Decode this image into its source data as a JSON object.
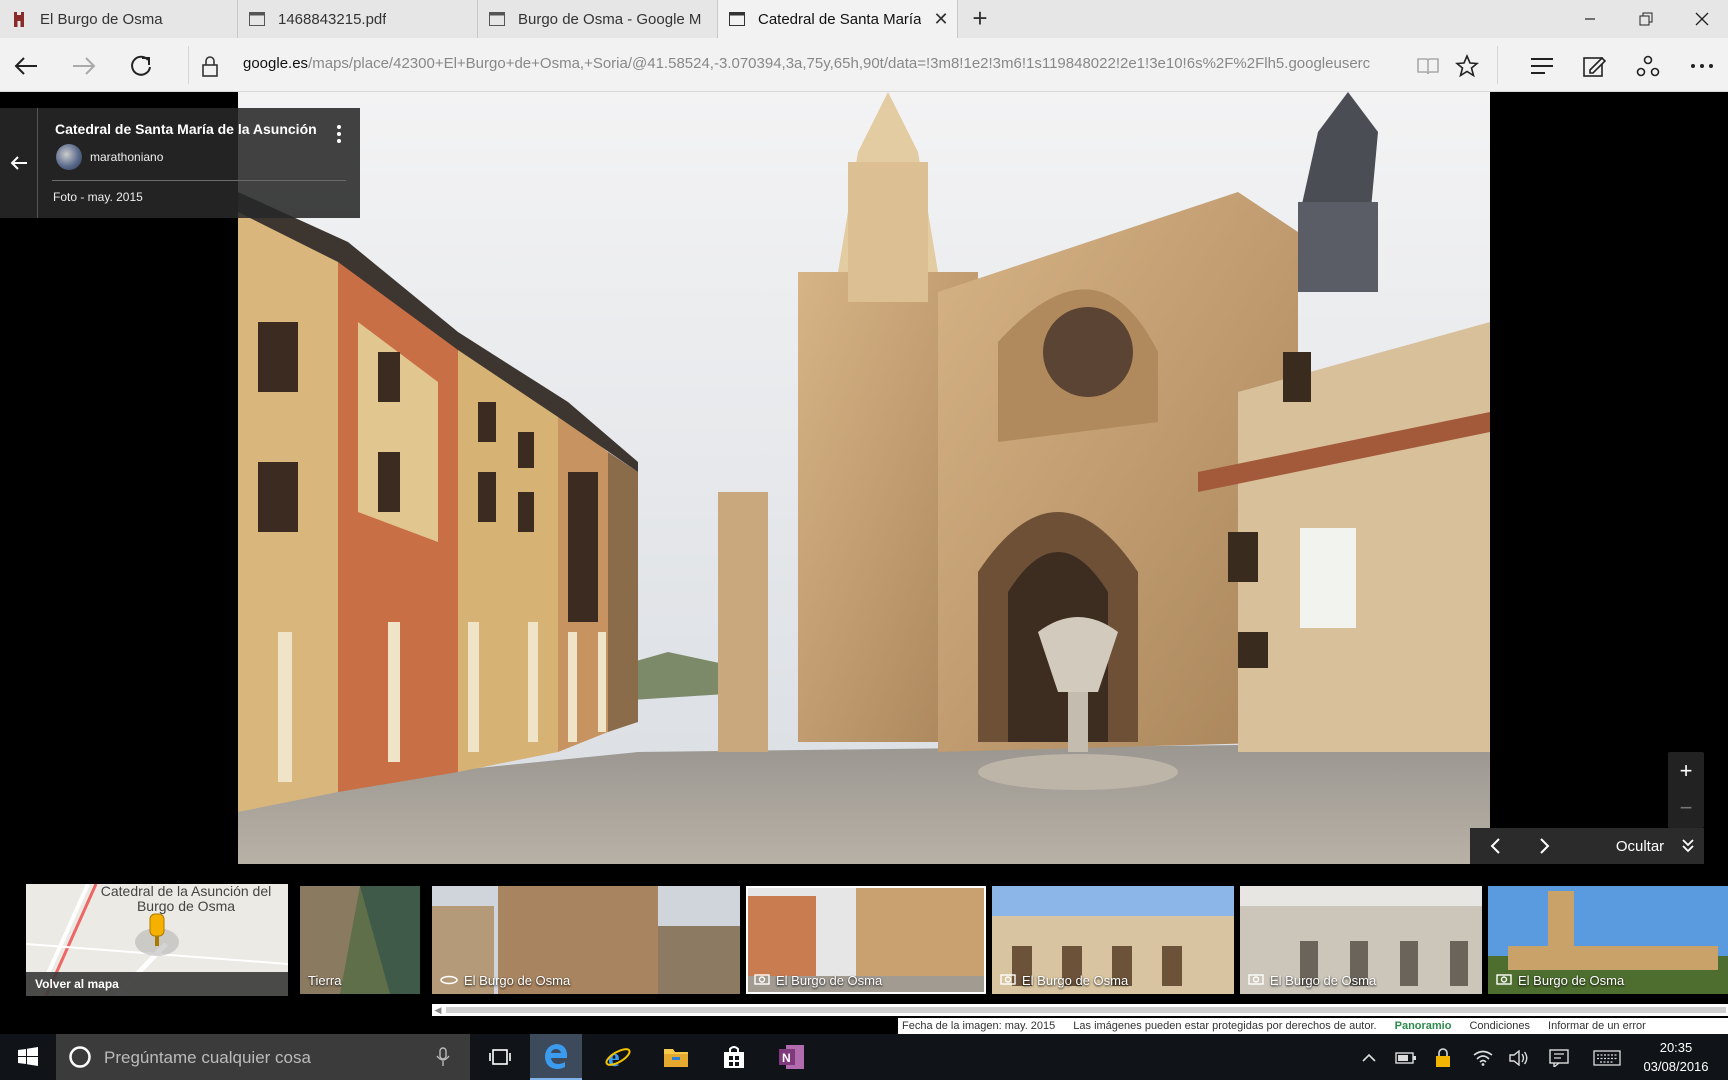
{
  "browser": {
    "tabs": [
      {
        "label": "El Burgo de Osma",
        "icon": "page-icon",
        "active": false
      },
      {
        "label": "1468843215.pdf",
        "icon": "pdf-icon",
        "active": false
      },
      {
        "label": "Burgo de Osma - Google M",
        "icon": "page-icon",
        "active": false
      },
      {
        "label": "Catedral de Santa María",
        "icon": "page-icon",
        "active": true
      }
    ],
    "close_tab": "✕",
    "new_tab": "+",
    "url_host": "google.es",
    "url_path": "/maps/place/42300+El+Burgo+de+Osma,+Soria/@41.58524,-3.070394,3a,75y,65h,90t/data=!3m8!1e2!3m6!1s119848022!2e1!3e10!6s%2F%2Flh5.googleuserc"
  },
  "photo_info": {
    "title": "Catedral de Santa María de la Asunción",
    "author": "marathoniano",
    "date": "Foto - may. 2015"
  },
  "controls": {
    "zoom_in": "+",
    "zoom_out": "−",
    "hide_label": "Ocultar"
  },
  "filmstrip": {
    "map_title": "Catedral de la Asunción del Burgo de Osma",
    "map_back_label": "Volver al mapa",
    "earth_label": "Tierra",
    "thumbs": [
      {
        "caption": "El Burgo de Osma",
        "icon": "panorama-icon"
      },
      {
        "caption": "El Burgo de Osma",
        "icon": "camera-icon"
      },
      {
        "caption": "El Burgo de Osma",
        "icon": "camera-icon"
      },
      {
        "caption": "El Burgo de Osma",
        "icon": "camera-icon"
      },
      {
        "caption": "El Burgo de Osma",
        "icon": "camera-icon"
      }
    ]
  },
  "attribution": {
    "date": "Fecha de la imagen: may. 2015",
    "copyright": "Las imágenes pueden estar protegidas por derechos de autor.",
    "panoramio": "Panoramio",
    "terms": "Condiciones",
    "report": "Informar de un error"
  },
  "taskbar": {
    "search_placeholder": "Pregúntame cualquier cosa",
    "time": "20:35",
    "date": "03/08/2016"
  },
  "colors": {
    "onenote": "#80397b",
    "edge": "#1e90e6",
    "tab_active": "#f2f2f2"
  }
}
